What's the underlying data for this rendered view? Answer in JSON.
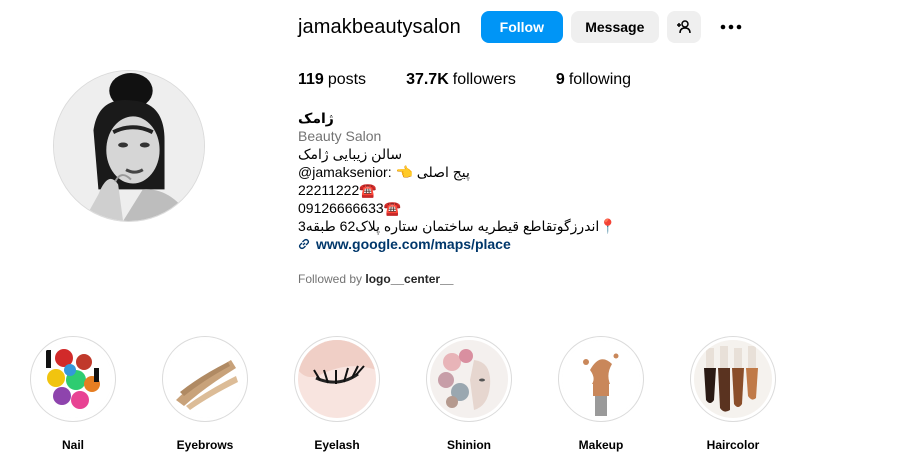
{
  "profile": {
    "username": "jamakbeautysalon",
    "follow_label": "Follow",
    "message_label": "Message",
    "add_user_icon": "add-user-icon",
    "more_icon": "more-options-icon"
  },
  "stats": {
    "posts_count": "119",
    "posts_label": "posts",
    "followers_count": "37.7K",
    "followers_label": "followers",
    "following_count": "9",
    "following_label": "following"
  },
  "bio": {
    "name": "ژامک",
    "category": "Beauty Salon",
    "line1": "سالن زیبایی ژامک",
    "line2": "پیج اصلی 👈 :jamaksenior@",
    "phone1": "22211222☎️",
    "phone2": "09126666633☎️",
    "address": "📍اندرزگوتقاطع قیطریه ساختمان ستاره پلاک62 طبقه3",
    "link": "www.google.com/maps/place",
    "followed_prefix": "Followed by",
    "followed_user": "logo__center__"
  },
  "highlights": [
    {
      "label": "Nail"
    },
    {
      "label": "Eyebrows"
    },
    {
      "label": "Eyelash"
    },
    {
      "label": "Shinion"
    },
    {
      "label": "Makeup"
    },
    {
      "label": "Haircolor"
    }
  ],
  "colors": {
    "follow_button": "#0095f6",
    "secondary_button": "#efefef",
    "link": "#00376b",
    "muted_text": "#737373"
  }
}
